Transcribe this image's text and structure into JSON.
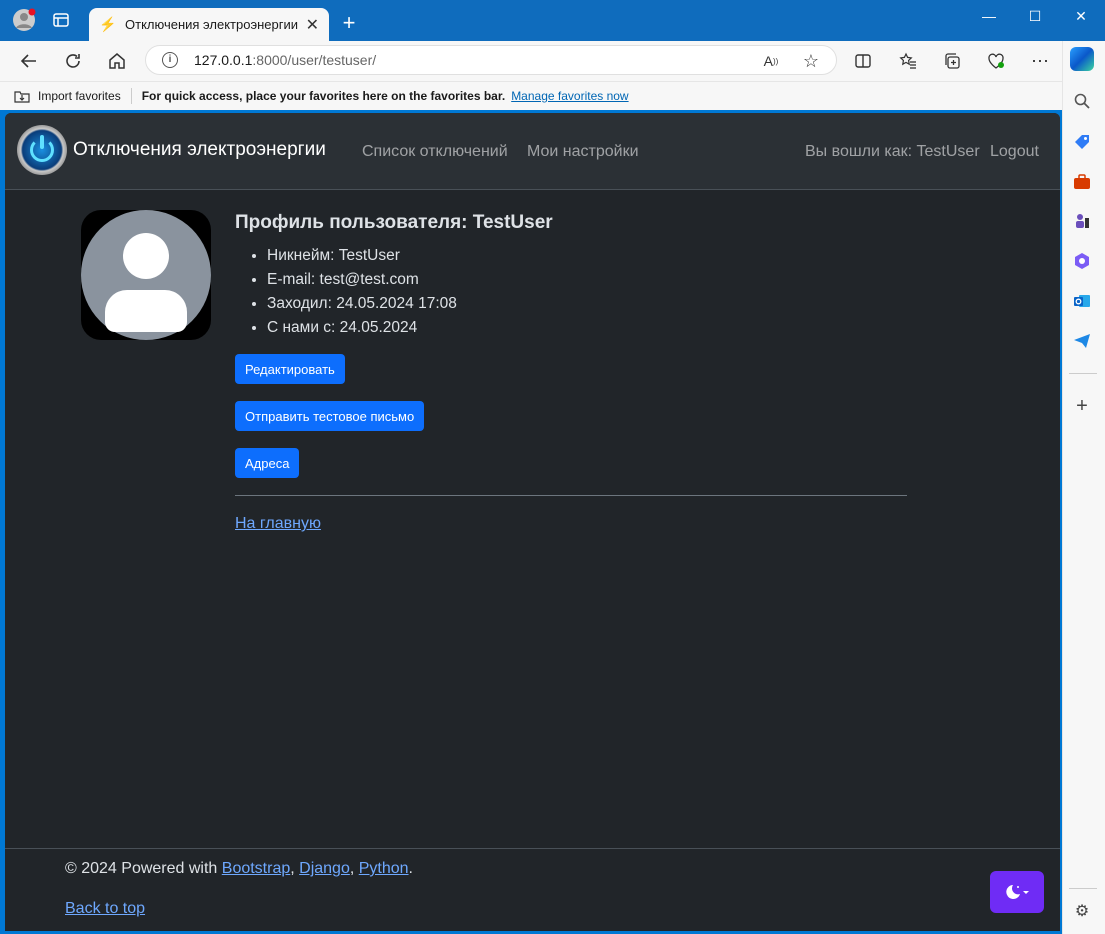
{
  "browser": {
    "tab_title": "Отключения электроэнергии",
    "address_host": "127.0.0.1",
    "address_port_path": ":8000/user/testuser/",
    "favbar": {
      "import_label": "Import favorites",
      "hint": "For quick access, place your favorites here on the favorites bar.",
      "manage_link": "Manage favorites now"
    }
  },
  "navbar": {
    "brand": "Отключения электроэнергии",
    "links": [
      "Список отключений",
      "Мои настройки"
    ],
    "logged_in_as": "Вы вошли как: TestUser",
    "logout": "Logout"
  },
  "profile": {
    "title": "Профиль пользователя: TestUser",
    "details": [
      "Никнейм: TestUser",
      "E-mail: test@test.com",
      "Заходил: 24.05.2024 17:08",
      "С нами с: 24.05.2024"
    ],
    "buttons": {
      "edit": "Редактировать",
      "test_email": "Отправить тестовое письмо",
      "addresses": "Адреса"
    },
    "home_link": "На главную"
  },
  "footer": {
    "prefix": "© 2024 Powered with ",
    "links": [
      "Bootstrap",
      "Django",
      "Python"
    ],
    "suffix": ".",
    "back_to_top": "Back to top"
  },
  "colors": {
    "primary": "#0d6efd",
    "theme_toggle": "#6f2cf5",
    "link": "#6ea8fe",
    "page_bg": "#212529",
    "navbar_bg": "#2b3035"
  }
}
